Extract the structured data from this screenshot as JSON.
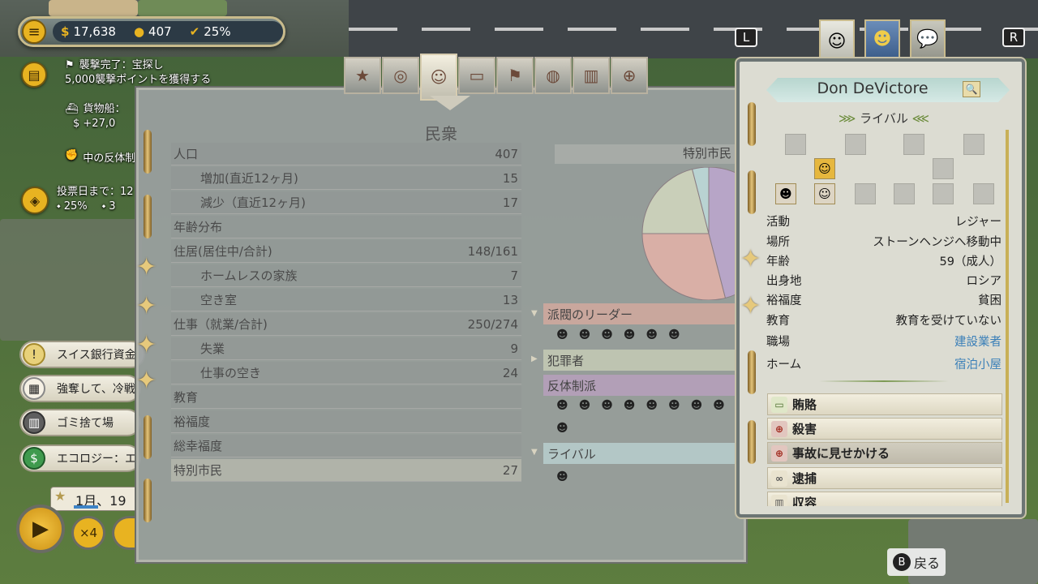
{
  "resources": {
    "money": "17,638",
    "population": "407",
    "approval": "25%"
  },
  "notifications": {
    "raid_title": "襲撃完了：宝探し",
    "raid_detail": "5,000襲撃ポイントを獲得する",
    "cargo_title": "貨物船：",
    "cargo_value": "$ +27,0",
    "rebel": "中の反体制",
    "election": "投票日まで：12",
    "election_pct1": "25%",
    "election_pct2": "3"
  },
  "left_menu": [
    {
      "label": "スイス銀行資金",
      "icon": "exclamation-icon"
    },
    {
      "label": "強奪して、冷戦",
      "icon": "calendar-icon"
    },
    {
      "label": "ゴミ捨て場",
      "icon": "trash-icon"
    },
    {
      "label": "エコロジー：エ",
      "icon": "dollar-icon"
    }
  ],
  "date": "1月、19",
  "speed": {
    "x4": "×4"
  },
  "main_panel": {
    "title": "民衆",
    "tabs": [
      "star-icon",
      "wreath-icon",
      "people-icon",
      "money-icon",
      "flag-icon",
      "globe-icon",
      "buildings-icon",
      "target-icon"
    ],
    "stats": [
      {
        "label": "人口",
        "value": "407",
        "sub": false
      },
      {
        "label": "増加(直近12ヶ月)",
        "value": "15",
        "sub": true
      },
      {
        "label": "減少（直近12ヶ月)",
        "value": "17",
        "sub": true
      },
      {
        "label": "年齢分布",
        "value": "",
        "sub": false
      },
      {
        "label": "住居(居住中/合計)",
        "value": "148/161",
        "sub": false
      },
      {
        "label": "ホームレスの家族",
        "value": "7",
        "sub": true
      },
      {
        "label": "空き室",
        "value": "13",
        "sub": true
      },
      {
        "label": "仕事（就業/合計)",
        "value": "250/274",
        "sub": false
      },
      {
        "label": "失業",
        "value": "9",
        "sub": true
      },
      {
        "label": "仕事の空き",
        "value": "24",
        "sub": true
      },
      {
        "label": "教育",
        "value": "",
        "sub": false
      },
      {
        "label": "裕福度",
        "value": "",
        "sub": false
      },
      {
        "label": "総幸福度",
        "value": "",
        "sub": false
      },
      {
        "label": "特別市民",
        "value": "27",
        "sub": false
      }
    ],
    "special_label": "特別市民",
    "groups": [
      {
        "label": "派閥のリーダー",
        "color": "#c9a79d"
      },
      {
        "label": "犯罪者",
        "color": "#bec4b1"
      },
      {
        "label": "反体制派",
        "color": "#b29fb7"
      },
      {
        "label": "ライバル",
        "color": "#b3c7c6"
      }
    ]
  },
  "chart_data": {
    "type": "pie",
    "title": "特別市民",
    "slices": [
      {
        "name": "反体制派",
        "value": 46,
        "color": "#b7a5c7"
      },
      {
        "name": "派閥のリーダー",
        "value": 29,
        "color": "#d9afa6"
      },
      {
        "name": "犯罪者",
        "value": 21,
        "color": "#c9cfb9"
      },
      {
        "name": "ライバル",
        "value": 4,
        "color": "#b9d3d2"
      }
    ]
  },
  "citizen": {
    "name": "Don DeVictore",
    "category": "ライバル",
    "fields": [
      {
        "k": "活動",
        "v": "レジャー",
        "link": false
      },
      {
        "k": "場所",
        "v": "ストーンヘンジへ移動中",
        "link": false
      },
      {
        "k": "年齢",
        "v": "59（成人）",
        "link": false
      },
      {
        "k": "出身地",
        "v": "ロシア",
        "link": false
      },
      {
        "k": "裕福度",
        "v": "貧困",
        "link": false
      },
      {
        "k": "教育",
        "v": "教育を受けていない",
        "link": false
      },
      {
        "k": "職場",
        "v": "建設業者",
        "link": true
      },
      {
        "k": "ホーム",
        "v": "宿泊小屋",
        "link": true
      }
    ],
    "actions": [
      {
        "label": "賄賂",
        "icon": "bribe-icon"
      },
      {
        "label": "殺害",
        "icon": "crosshair-icon"
      },
      {
        "label": "事故に見せかける",
        "icon": "crosshair-icon"
      },
      {
        "label": "逮捕",
        "icon": "handcuff-icon"
      },
      {
        "label": "収容",
        "icon": "prison-icon"
      }
    ]
  },
  "keys": {
    "L": "L",
    "R": "R",
    "back_key": "B",
    "back_label": "戻る"
  }
}
